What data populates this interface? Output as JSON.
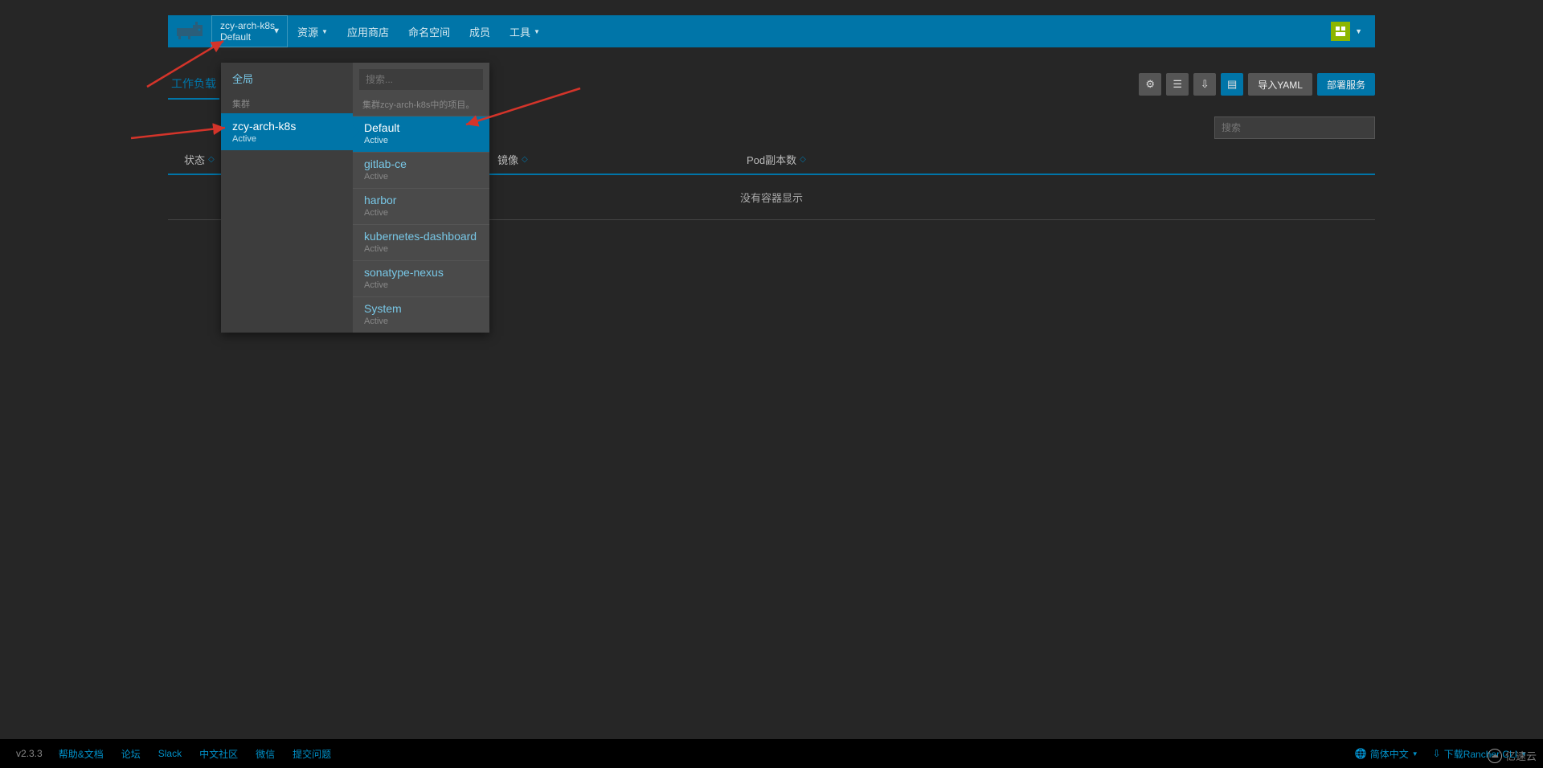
{
  "header": {
    "cluster_name": "zcy-arch-k8s",
    "project_name": "Default",
    "nav": {
      "resources": "资源",
      "app_store": "应用商店",
      "namespaces": "命名空间",
      "members": "成员",
      "tools": "工具"
    }
  },
  "dropdown": {
    "global": "全局",
    "cluster_label": "集群",
    "clusters": [
      {
        "name": "zcy-arch-k8s",
        "status": "Active"
      }
    ],
    "search_placeholder": "搜索...",
    "hint": "集群zcy-arch-k8s中的项目。",
    "projects": [
      {
        "name": "Default",
        "status": "Active",
        "active": true
      },
      {
        "name": "gitlab-ce",
        "status": "Active",
        "active": false
      },
      {
        "name": "harbor",
        "status": "Active",
        "active": false
      },
      {
        "name": "kubernetes-dashboard",
        "status": "Active",
        "active": false
      },
      {
        "name": "sonatype-nexus",
        "status": "Active",
        "active": false
      },
      {
        "name": "System",
        "status": "Active",
        "active": false
      }
    ]
  },
  "toolbar": {
    "tab": "工作负载",
    "import_yaml": "导入YAML",
    "deploy": "部署服务"
  },
  "filter": {
    "search_placeholder": "搜索"
  },
  "table": {
    "cols": {
      "status": "状态",
      "image": "镜像",
      "replicas": "Pod副本数"
    },
    "empty": "没有容器显示"
  },
  "footer": {
    "version": "v2.3.3",
    "links": {
      "help": "帮助&文档",
      "forum": "论坛",
      "slack": "Slack",
      "cn_community": "中文社区",
      "wechat": "微信",
      "issue": "提交问题"
    },
    "lang": "简体中文",
    "download_cli": "下载Rancher CLI"
  },
  "watermark": "亿速云"
}
